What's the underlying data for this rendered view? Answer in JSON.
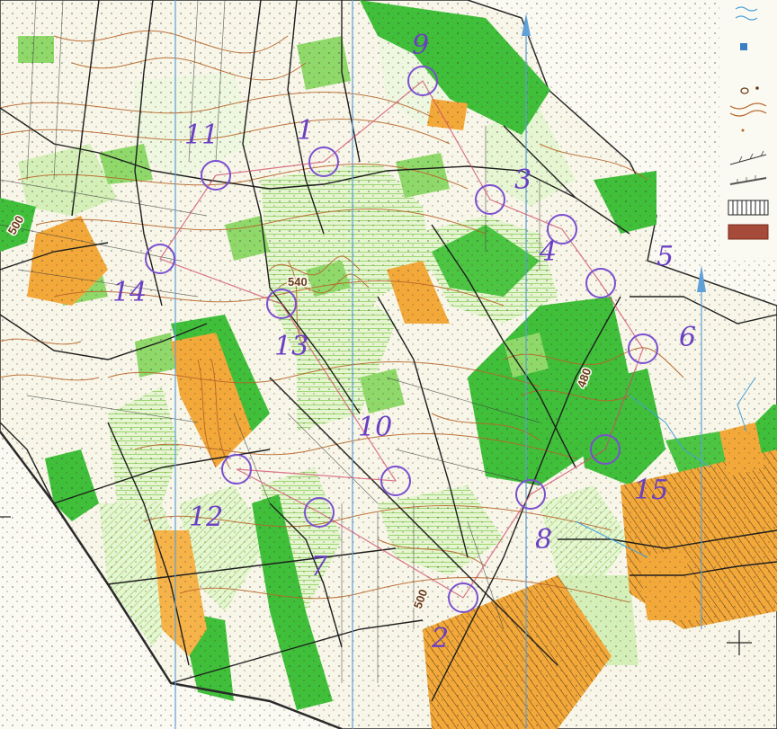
{
  "map": {
    "contour_labels": [
      "500",
      "540",
      "480",
      "500"
    ]
  },
  "course": {
    "color": "#7b4fd0",
    "leg_color": "#d24a6a",
    "controls": [
      {
        "label": "1"
      },
      {
        "label": "2"
      },
      {
        "label": "3"
      },
      {
        "label": "4"
      },
      {
        "label": "5"
      },
      {
        "label": "6"
      },
      {
        "label": "7"
      },
      {
        "label": "8"
      },
      {
        "label": "9"
      },
      {
        "label": "10"
      },
      {
        "label": "11"
      },
      {
        "label": "12"
      },
      {
        "label": "13"
      },
      {
        "label": "14"
      },
      {
        "label": "15"
      }
    ]
  },
  "legend": {
    "symbols": [
      "water-marsh-icon",
      "boulder-icon",
      "pit-icon",
      "contour-icon",
      "point-feature-icon",
      "fence-icon",
      "cliff-icon",
      "cultivated-land-icon",
      "out-of-bounds-icon"
    ]
  },
  "colors": {
    "forest_dark": "#3fbf3a",
    "forest_mid": "#8fd96a",
    "forest_light": "#d4f0b8",
    "open_land": "#f3a93a",
    "paper": "#fbfaf2",
    "contour": "#b8652a"
  }
}
